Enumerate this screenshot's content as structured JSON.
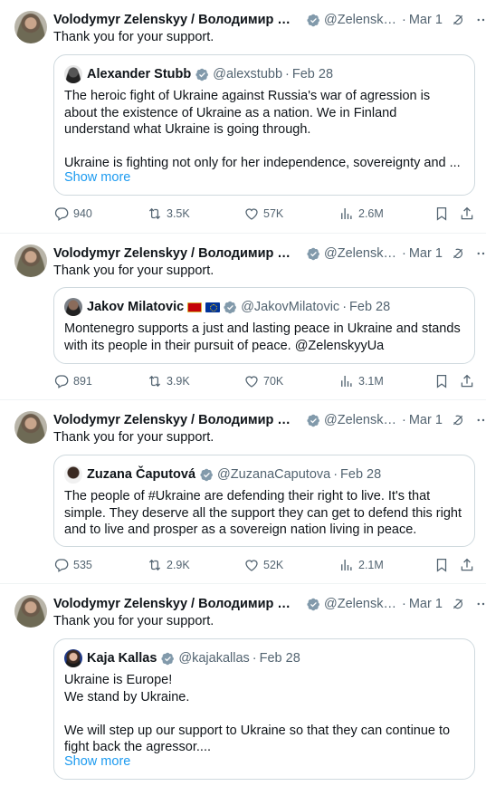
{
  "colors": {
    "accent": "#1d9bf0",
    "muted": "#536471",
    "verified": "#829aab"
  },
  "posts": [
    {
      "author": "Volodymyr Zelenskyy / Володимир Зел...",
      "handle": "@ZelenskyyUa",
      "date": "Mar 1",
      "text": "Thank you for your support.",
      "quote": {
        "author": "Alexander Stubb",
        "handle": "@alexstubb",
        "date": "Feb 28",
        "paragraphs": [
          "The heroic fight of Ukraine against Russia's war of agression is about the existence of Ukraine as a nation. We in Finland understand what Ukraine is going through.",
          "",
          "Ukraine is fighting not only for her independence, sovereignty and ..."
        ],
        "show_more": "Show more"
      },
      "stats": {
        "replies": "940",
        "reposts": "3.5K",
        "likes": "57K",
        "views": "2.6M"
      }
    },
    {
      "author": "Volodymyr Zelenskyy / Володимир Зел...",
      "handle": "@ZelenskyyUa",
      "date": "Mar 1",
      "text": "Thank you for your support.",
      "quote": {
        "author": "Jakov Milatovic",
        "handle": "@JakovMilatovic",
        "date": "Feb 28",
        "paragraphs": [
          "Montenegro supports a just and lasting peace in Ukraine and stands with its people in their pursuit of peace. @ZelenskyyUa"
        ]
      },
      "stats": {
        "replies": "891",
        "reposts": "3.9K",
        "likes": "70K",
        "views": "3.1M"
      }
    },
    {
      "author": "Volodymyr Zelenskyy / Володимир Зел...",
      "handle": "@ZelenskyyUa",
      "date": "Mar 1",
      "text": "Thank you for your support.",
      "quote": {
        "author": "Zuzana Čaputová",
        "handle": "@ZuzanaCaputova",
        "date": "Feb 28",
        "paragraphs": [
          "The people of #Ukraine are defending their right to live. It's that simple. They deserve all the support they can get to defend this right and to live and prosper as a sovereign nation living in peace."
        ]
      },
      "stats": {
        "replies": "535",
        "reposts": "2.9K",
        "likes": "52K",
        "views": "2.1M"
      }
    },
    {
      "author": "Volodymyr Zelenskyy / Володимир Зел...",
      "handle": "@ZelenskyyUa",
      "date": "Mar 1",
      "text": "Thank you for your support.",
      "quote": {
        "author": "Kaja Kallas",
        "handle": "@kajakallas",
        "date": "Feb 28",
        "paragraphs": [
          "Ukraine is Europe!",
          "We stand by Ukraine.",
          "",
          "We will step up our support to Ukraine so that they can continue to fight back the agressor...."
        ],
        "show_more": "Show more"
      }
    }
  ]
}
